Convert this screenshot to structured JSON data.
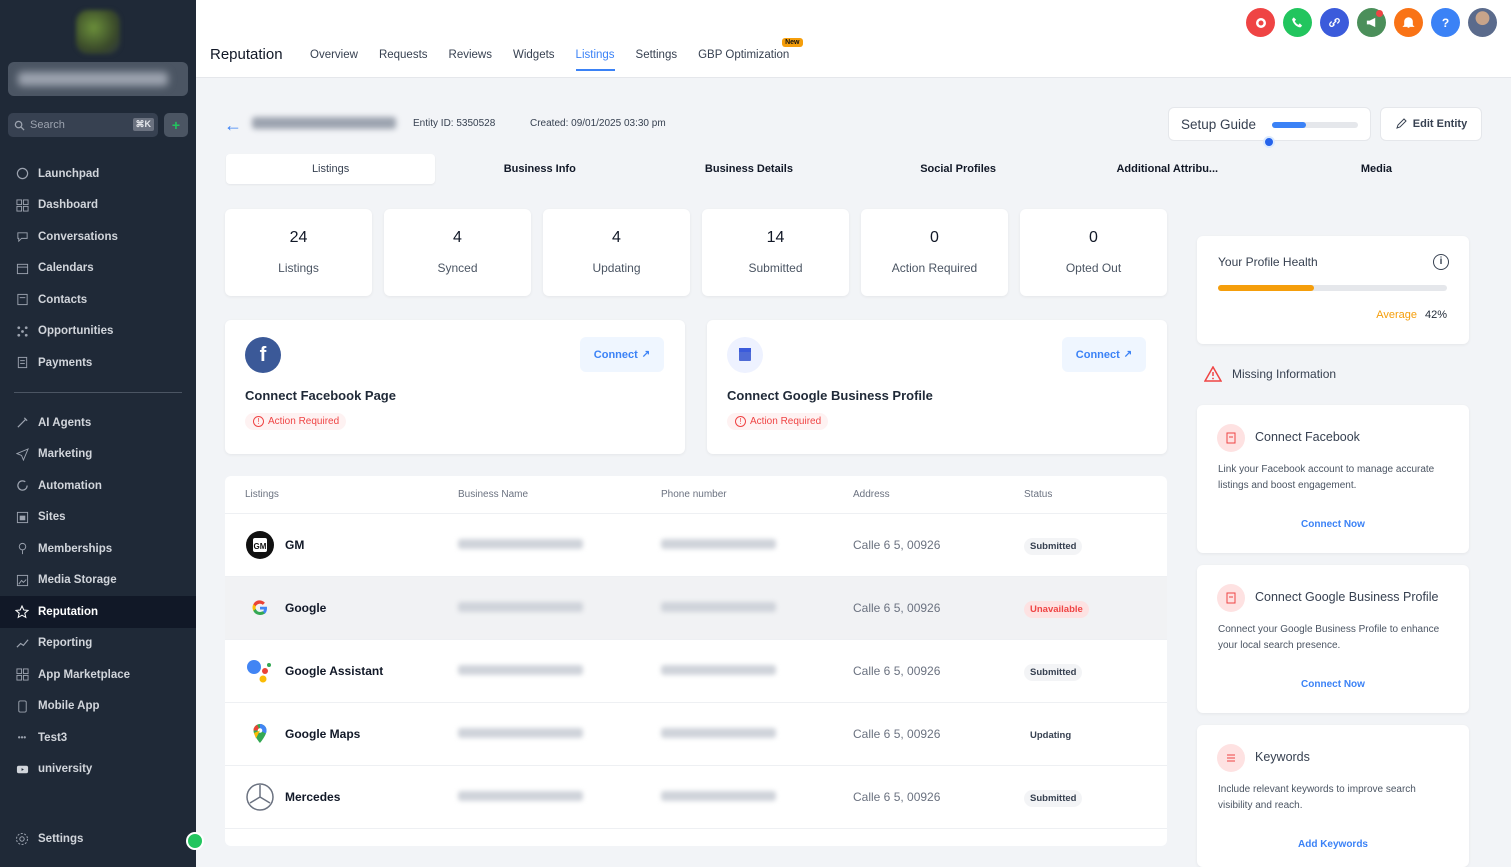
{
  "sidebar": {
    "search_placeholder": "Search",
    "search_shortcut": "⌘K",
    "add_label": "+",
    "items_top": [
      {
        "label": "Launchpad",
        "icon": "launchpad-icon"
      },
      {
        "label": "Dashboard",
        "icon": "dashboard-icon"
      },
      {
        "label": "Conversations",
        "icon": "chat-icon"
      },
      {
        "label": "Calendars",
        "icon": "calendar-icon"
      },
      {
        "label": "Contacts",
        "icon": "contacts-icon"
      },
      {
        "label": "Opportunities",
        "icon": "opportunities-icon"
      },
      {
        "label": "Payments",
        "icon": "payments-icon"
      }
    ],
    "items_bottom": [
      {
        "label": "AI Agents",
        "icon": "ai-agents-icon"
      },
      {
        "label": "Marketing",
        "icon": "send-icon"
      },
      {
        "label": "Automation",
        "icon": "automation-icon"
      },
      {
        "label": "Sites",
        "icon": "sites-icon"
      },
      {
        "label": "Memberships",
        "icon": "memberships-icon"
      },
      {
        "label": "Media Storage",
        "icon": "media-icon"
      },
      {
        "label": "Reputation",
        "icon": "star-icon",
        "active": true
      },
      {
        "label": "Reporting",
        "icon": "reporting-icon"
      },
      {
        "label": "App Marketplace",
        "icon": "marketplace-icon"
      },
      {
        "label": "Mobile App",
        "icon": "mobile-icon"
      },
      {
        "label": "Test3",
        "icon": "test-icon"
      },
      {
        "label": "university",
        "icon": "university-icon"
      }
    ],
    "settings_label": "Settings"
  },
  "header": {
    "title": "Reputation",
    "tabs": [
      {
        "label": "Overview"
      },
      {
        "label": "Requests"
      },
      {
        "label": "Reviews"
      },
      {
        "label": "Widgets"
      },
      {
        "label": "Listings",
        "active": true
      },
      {
        "label": "Settings"
      },
      {
        "label": "GBP Optimization",
        "badge": "New"
      }
    ],
    "icons": [
      {
        "name": "record-icon",
        "color": "#ef4444"
      },
      {
        "name": "phone-icon",
        "color": "#22c55e"
      },
      {
        "name": "link-icon",
        "color": "#3b5bdb"
      },
      {
        "name": "megaphone-icon",
        "color": "#4b8f5a"
      },
      {
        "name": "bell-icon",
        "color": "#f97316"
      },
      {
        "name": "help-icon",
        "color": "#3b82f6"
      },
      {
        "name": "avatar-icon",
        "color": "#6b7280"
      }
    ]
  },
  "entity": {
    "id_text": "Entity ID: 5350528",
    "created_text": "Created: 09/01/2025 03:30 pm",
    "setup_guide": "Setup Guide",
    "setup_progress": 0.4,
    "edit_label": "Edit Entity"
  },
  "subtabs": [
    {
      "label": "Listings",
      "active": true
    },
    {
      "label": "Business Info"
    },
    {
      "label": "Business Details"
    },
    {
      "label": "Social Profiles"
    },
    {
      "label": "Additional Attribu..."
    },
    {
      "label": "Media"
    }
  ],
  "stats": [
    {
      "value": "24",
      "label": "Listings"
    },
    {
      "value": "4",
      "label": "Synced"
    },
    {
      "value": "4",
      "label": "Updating"
    },
    {
      "value": "14",
      "label": "Submitted"
    },
    {
      "value": "0",
      "label": "Action Required"
    },
    {
      "value": "0",
      "label": "Opted Out"
    }
  ],
  "connect_cards": [
    {
      "title": "Connect Facebook Page",
      "button": "Connect",
      "badge": "Action Required"
    },
    {
      "title": "Connect Google Business Profile",
      "button": "Connect",
      "badge": "Action Required"
    }
  ],
  "table": {
    "headers": [
      "Listings",
      "Business Name",
      "Phone number",
      "Address",
      "Status"
    ],
    "rows": [
      {
        "name": "GM",
        "address": "Calle 6 5, 00926",
        "status": "Submitted"
      },
      {
        "name": "Google",
        "address": "Calle 6 5, 00926",
        "status": "Unavailable"
      },
      {
        "name": "Google Assistant",
        "address": "Calle 6 5, 00926",
        "status": "Submitted"
      },
      {
        "name": "Google Maps",
        "address": "Calle 6 5, 00926",
        "status": "Updating"
      },
      {
        "name": "Mercedes",
        "address": "Calle 6 5, 00926",
        "status": "Submitted"
      }
    ]
  },
  "profile_health": {
    "title": "Your Profile Health",
    "rating": "Average",
    "percent": "42%",
    "progress": 0.42
  },
  "missing": {
    "title": "Missing Information",
    "cards": [
      {
        "title": "Connect Facebook",
        "desc": "Link your Facebook account to manage accurate listings and boost engagement.",
        "link": "Connect Now"
      },
      {
        "title": "Connect Google Business Profile",
        "desc": "Connect your Google Business Profile to enhance your local search presence.",
        "link": "Connect Now"
      },
      {
        "title": "Keywords",
        "desc": "Include relevant keywords to improve search visibility and reach.",
        "link": "Add Keywords"
      }
    ]
  }
}
